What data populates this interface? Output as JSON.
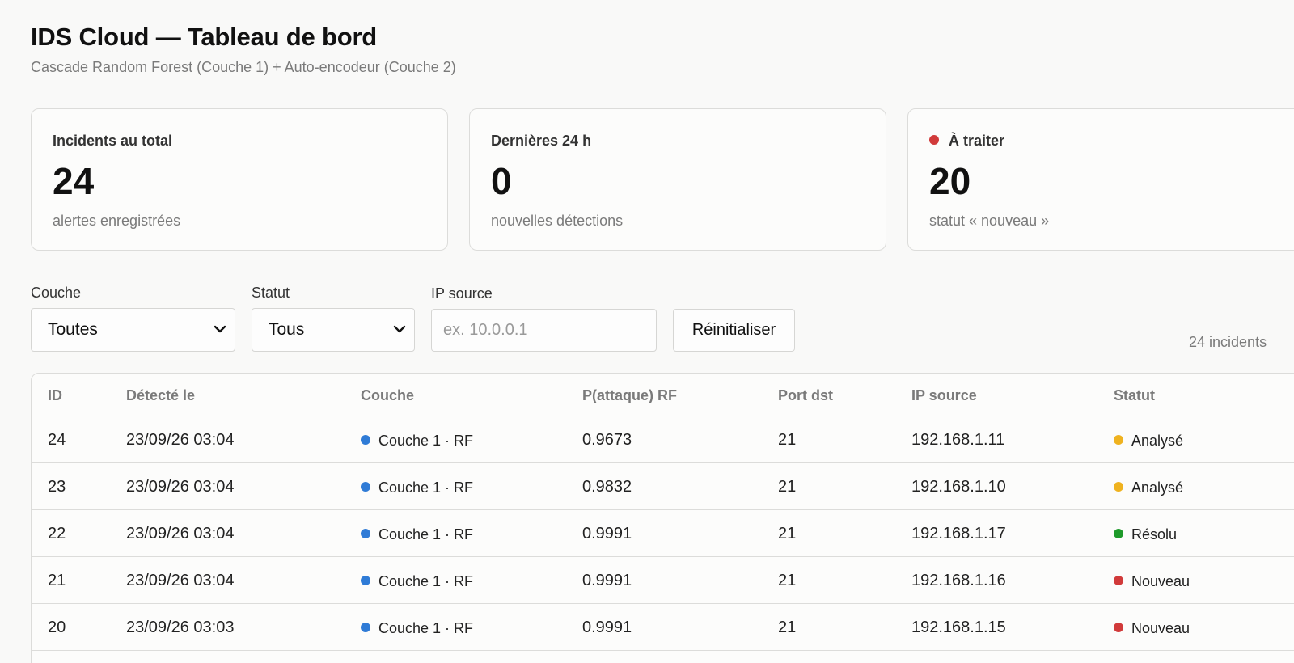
{
  "header": {
    "title": "IDS Cloud — Tableau de bord",
    "subtitle": "Cascade Random Forest (Couche 1) + Auto-encodeur (Couche 2)"
  },
  "cards": [
    {
      "label": "Incidents au total",
      "value": "24",
      "hint": "alertes enregistrées"
    },
    {
      "label": "Dernières 24 h",
      "value": "0",
      "hint": "nouvelles détections"
    },
    {
      "label": "À traiter",
      "value": "20",
      "hint": "statut « nouveau »",
      "dot_color": "#d13a3a"
    }
  ],
  "filters": {
    "layer_label": "Couche",
    "layer_value": "Toutes",
    "status_label": "Statut",
    "status_value": "Tous",
    "ip_label": "IP source",
    "ip_placeholder": "ex. 10.0.0.1",
    "reset_label": "Réinitialiser",
    "count_text": "24 incidents"
  },
  "table": {
    "columns": [
      "ID",
      "Détecté le",
      "Couche",
      "P(attaque) RF",
      "Port dst",
      "IP source",
      "Statut"
    ],
    "rows": [
      {
        "id": "24",
        "detected": "23/09/26 03:04",
        "layer": "Couche 1 · RF",
        "p": "0.9673",
        "port": "21",
        "ip": "192.168.1.11",
        "status": "Analysé"
      },
      {
        "id": "23",
        "detected": "23/09/26 03:04",
        "layer": "Couche 1 · RF",
        "p": "0.9832",
        "port": "21",
        "ip": "192.168.1.10",
        "status": "Analysé"
      },
      {
        "id": "22",
        "detected": "23/09/26 03:04",
        "layer": "Couche 1 · RF",
        "p": "0.9991",
        "port": "21",
        "ip": "192.168.1.17",
        "status": "Résolu"
      },
      {
        "id": "21",
        "detected": "23/09/26 03:04",
        "layer": "Couche 1 · RF",
        "p": "0.9991",
        "port": "21",
        "ip": "192.168.1.16",
        "status": "Nouveau"
      },
      {
        "id": "20",
        "detected": "23/09/26 03:03",
        "layer": "Couche 1 · RF",
        "p": "0.9991",
        "port": "21",
        "ip": "192.168.1.15",
        "status": "Nouveau"
      }
    ]
  },
  "colors": {
    "layer_rf": "#2f7bd6",
    "status_analyse": "#efb21f",
    "status_resolu": "#1e9a2a",
    "status_nouveau": "#d13a3a"
  }
}
